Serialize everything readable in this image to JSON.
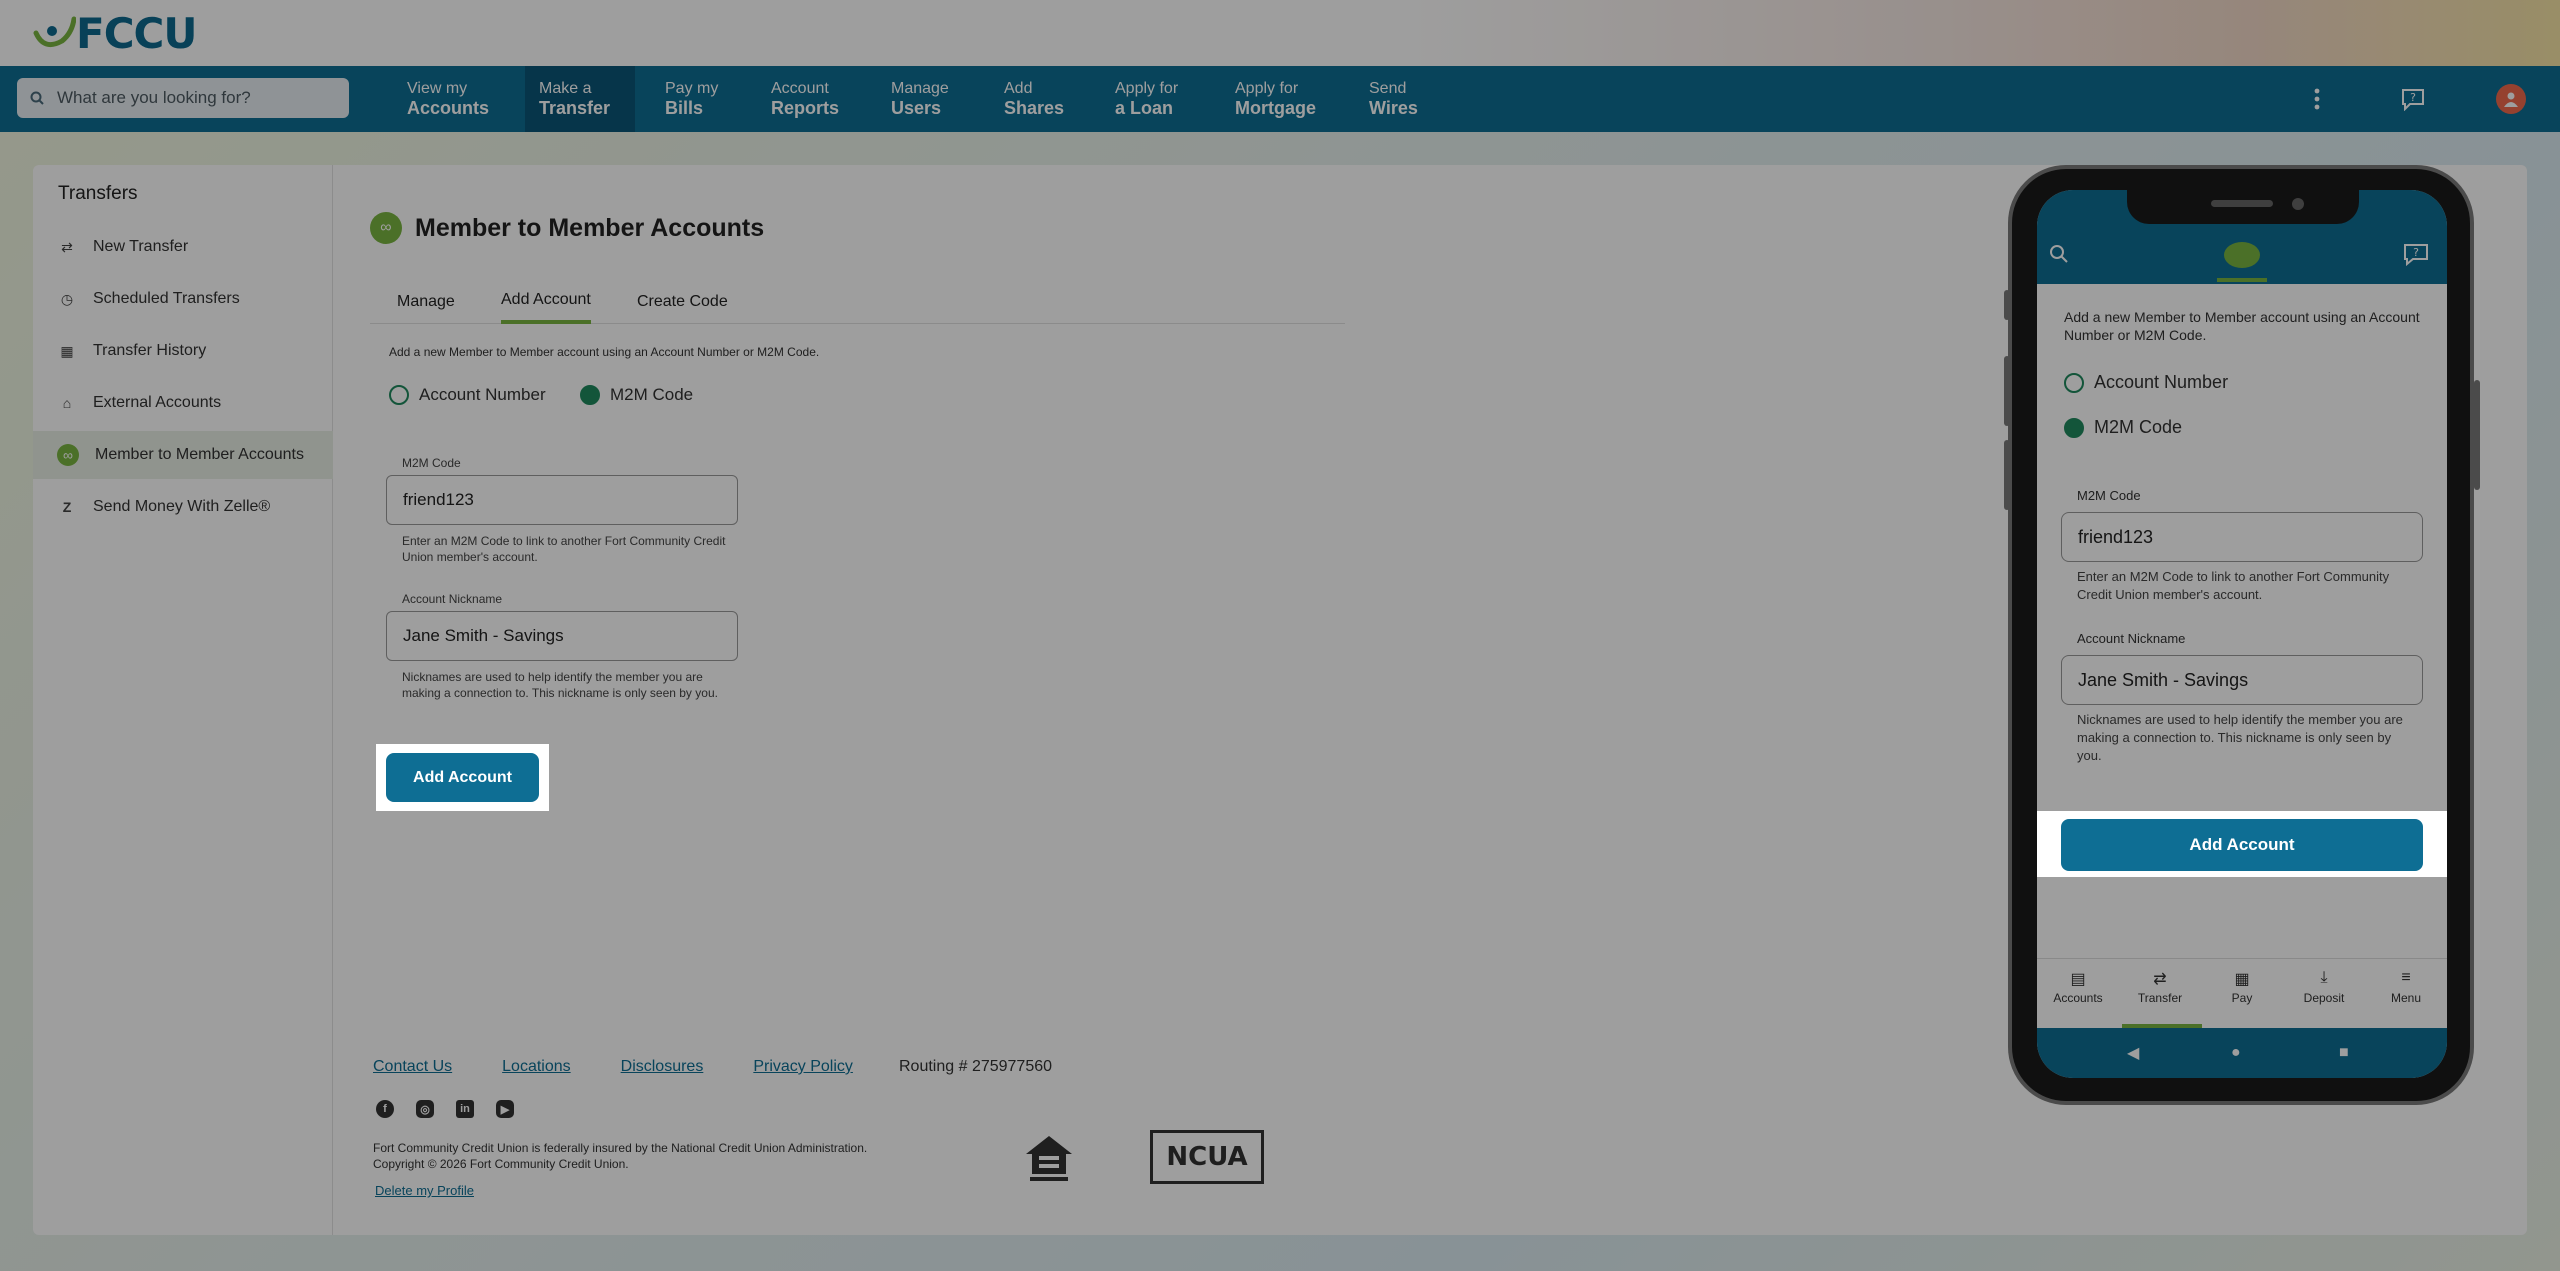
{
  "brand": {
    "name": "FCCU",
    "nav_color": "#0e6e94",
    "accent": "#7ab541"
  },
  "search": {
    "placeholder": "What are you looking for?",
    "icon": "search-icon"
  },
  "nav": [
    {
      "l1": "View my",
      "l2": "Accounts"
    },
    {
      "l1": "Make a",
      "l2": "Transfer",
      "active": true
    },
    {
      "l1": "Pay my",
      "l2": "Bills"
    },
    {
      "l1": "Account",
      "l2": "Reports"
    },
    {
      "l1": "Manage",
      "l2": "Users"
    },
    {
      "l1": "Add",
      "l2": "Shares"
    },
    {
      "l1": "Apply for",
      "l2": "a Loan"
    },
    {
      "l1": "Apply for",
      "l2": "Mortgage"
    },
    {
      "l1": "Send",
      "l2": "Wires"
    }
  ],
  "sidebar": {
    "title": "Transfers",
    "items": [
      {
        "label": "New Transfer",
        "icon": "arrows-icon"
      },
      {
        "label": "Scheduled Transfers",
        "icon": "clock-icon"
      },
      {
        "label": "Transfer History",
        "icon": "calendar-icon"
      },
      {
        "label": "External Accounts",
        "icon": "bank-icon"
      },
      {
        "label": "Member to Member Accounts",
        "icon": "link-icon",
        "active": true
      },
      {
        "label": "Send Money With Zelle®",
        "icon": "zelle-icon"
      }
    ]
  },
  "main": {
    "title": "Member to Member Accounts",
    "tabs": [
      "Manage",
      "Add Account",
      "Create Code"
    ],
    "active_tab": "Add Account",
    "description": "Add a new Member to Member account using an Account Number or M2M Code.",
    "radio_account_number": "Account Number",
    "radio_m2m": "M2M Code",
    "selected": "M2M Code",
    "m2m_label": "M2M Code",
    "m2m_value": "friend123",
    "m2m_help": "Enter an M2M Code to link to another Fort Community Credit Union member's account.",
    "nickname_label": "Account Nickname",
    "nickname_value": "Jane Smith - Savings",
    "nickname_help": "Nicknames are used to help identify the member you are making a connection to. This nickname is only seen by you.",
    "add_button": "Add Account"
  },
  "footer": {
    "links": [
      "Contact Us",
      "Locations",
      "Disclosures",
      "Privacy Policy"
    ],
    "routing": "Routing # 275977560",
    "legal1": "Fort Community Credit Union is federally insured by the National Credit Union Administration.",
    "legal2": "Copyright © 2026 Fort Community Credit Union.",
    "delete": "Delete my Profile",
    "ncua": "NCUA"
  },
  "phone": {
    "description": "Add a new Member to Member account using an Account Number or M2M Code.",
    "radio_account_number": "Account Number",
    "radio_m2m": "M2M Code",
    "m2m_label": "M2M Code",
    "m2m_value": "friend123",
    "m2m_help": "Enter an M2M Code to link to another Fort Community Credit Union member's account.",
    "nickname_label": "Account Nickname",
    "nickname_value": "Jane Smith - Savings",
    "nickname_help": "Nicknames are used to help identify the member you are making a connection to. This nickname is only seen by you.",
    "add_button": "Add Account",
    "nav": [
      "Accounts",
      "Transfer",
      "Pay",
      "Deposit",
      "Menu"
    ]
  }
}
